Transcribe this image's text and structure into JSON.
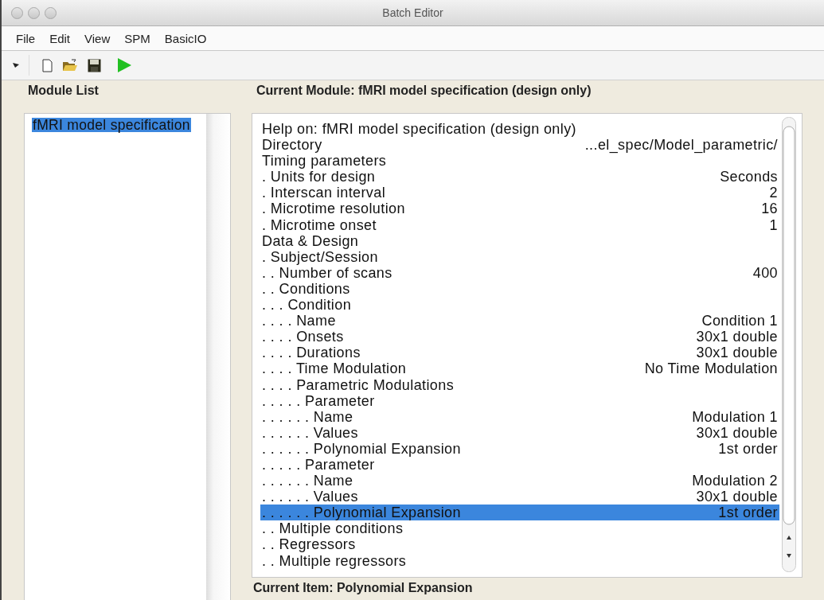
{
  "window": {
    "title": "Batch Editor"
  },
  "menu": [
    "File",
    "Edit",
    "View",
    "SPM",
    "BasicIO"
  ],
  "module_list": {
    "heading": "Module List",
    "items": [
      {
        "label": "fMRI model specification",
        "selected": true
      }
    ]
  },
  "current_module": {
    "heading": "Current Module: fMRI model specification (design only)",
    "rows": [
      {
        "label": "Help on: fMRI model specification (design only)",
        "value": "",
        "selected": false
      },
      {
        "label": "Directory",
        "value": "...el_spec/Model_parametric/",
        "selected": false
      },
      {
        "label": "Timing parameters",
        "value": "",
        "selected": false
      },
      {
        "label": ". Units for design",
        "value": "Seconds",
        "selected": false
      },
      {
        "label": ". Interscan interval",
        "value": "2",
        "selected": false
      },
      {
        "label": ". Microtime resolution",
        "value": "16",
        "selected": false
      },
      {
        "label": ". Microtime onset",
        "value": "1",
        "selected": false
      },
      {
        "label": "Data & Design",
        "value": "",
        "selected": false
      },
      {
        "label": ". Subject/Session",
        "value": "",
        "selected": false
      },
      {
        "label": ". . Number of scans",
        "value": "400",
        "selected": false
      },
      {
        "label": ". . Conditions",
        "value": "",
        "selected": false
      },
      {
        "label": ". . . Condition",
        "value": "",
        "selected": false
      },
      {
        "label": ". . . . Name",
        "value": "Condition 1",
        "selected": false
      },
      {
        "label": ". . . . Onsets",
        "value": "30x1 double",
        "selected": false
      },
      {
        "label": ". . . . Durations",
        "value": "30x1 double",
        "selected": false
      },
      {
        "label": ". . . . Time Modulation",
        "value": "No Time Modulation",
        "selected": false
      },
      {
        "label": ". . . . Parametric Modulations",
        "value": "",
        "selected": false
      },
      {
        "label": ". . . . . Parameter",
        "value": "",
        "selected": false
      },
      {
        "label": ". . . . . . Name",
        "value": "Modulation 1",
        "selected": false
      },
      {
        "label": ". . . . . . Values",
        "value": "30x1 double",
        "selected": false
      },
      {
        "label": ". . . . . . Polynomial Expansion",
        "value": "1st order",
        "selected": false
      },
      {
        "label": ". . . . . Parameter",
        "value": "",
        "selected": false
      },
      {
        "label": ". . . . . . Name",
        "value": "Modulation 2",
        "selected": false
      },
      {
        "label": ". . . . . . Values",
        "value": "30x1 double",
        "selected": false
      },
      {
        "label": ". . . . . . Polynomial Expansion",
        "value": "1st order",
        "selected": true
      },
      {
        "label": ". . Multiple conditions",
        "value": "",
        "selected": false
      },
      {
        "label": ". . Regressors",
        "value": "",
        "selected": false
      },
      {
        "label": ". . Multiple regressors",
        "value": "",
        "selected": false
      }
    ]
  },
  "current_item": "Current Item: Polynomial Expansion"
}
